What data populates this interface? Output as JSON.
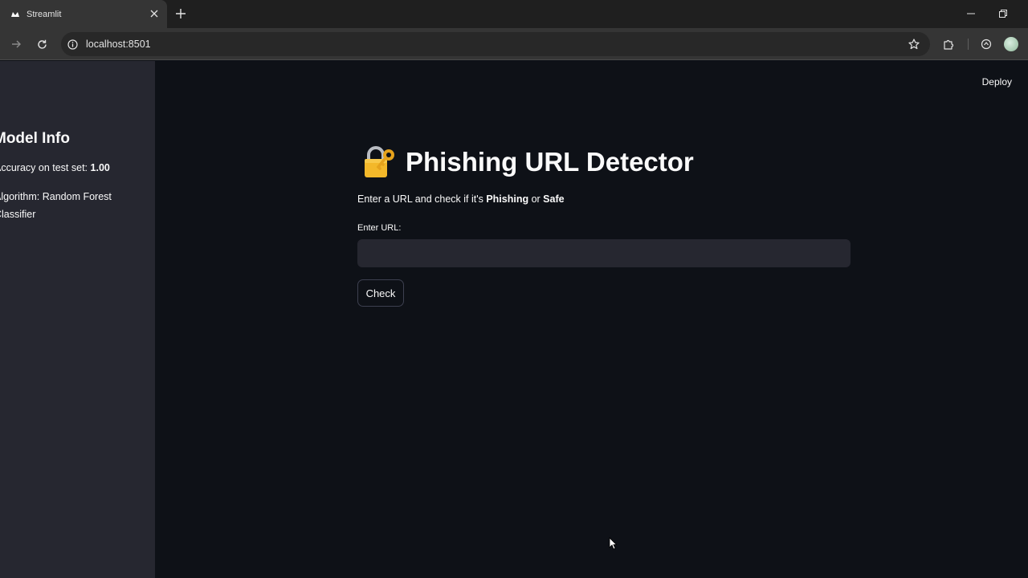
{
  "browser": {
    "tab_title": "Streamlit",
    "url": "localhost:8501",
    "icons": [
      "streamlit-favicon",
      "close-icon",
      "plus-icon",
      "minimize-icon",
      "restore-icon",
      "forward-icon",
      "reload-icon",
      "site-info-icon",
      "star-icon",
      "extensions-icon",
      "sync-icon",
      "profile-avatar"
    ]
  },
  "sidebar": {
    "title": "Model Info",
    "accuracy_label": "Accuracy on test set:",
    "accuracy_value": "1.00",
    "algorithm_line1": "Algorithm: Random Forest",
    "algorithm_line2": "Classifier"
  },
  "header": {
    "deploy_label": "Deploy"
  },
  "main": {
    "title_icon": "lock-with-key-icon",
    "title": "Phishing URL Detector",
    "subtitle_prefix": "Enter a URL and check if it's ",
    "subtitle_phishing": "Phishing",
    "subtitle_or": " or ",
    "subtitle_safe": "Safe",
    "input_label": "Enter URL:",
    "input_value": "",
    "check_label": "Check"
  },
  "colors": {
    "app_background": "#0e1117",
    "sidebar_background": "#262730",
    "input_background": "#262730",
    "text": "#fafafa",
    "browser_tab": "#353535",
    "browser_frame": "#1f1f1f"
  }
}
